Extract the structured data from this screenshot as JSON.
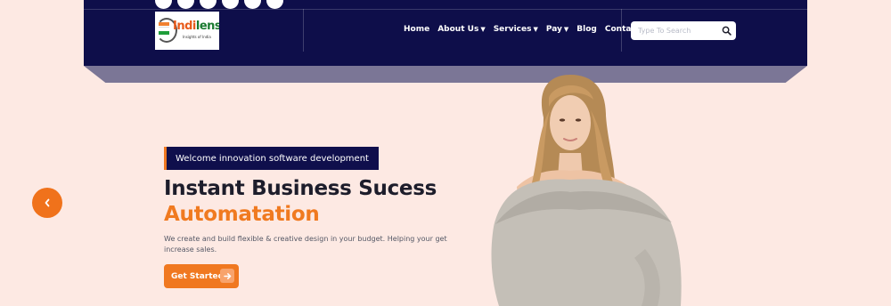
{
  "header": {
    "logo": {
      "name": "Indilens",
      "name_part1": "Indi",
      "name_part2": "lens",
      "tagline": "Insights of India"
    },
    "social_icons": [
      "social-icon-1",
      "social-icon-2",
      "social-icon-3",
      "social-icon-4",
      "social-icon-5",
      "social-icon-6"
    ],
    "nav": [
      {
        "label": "Home",
        "has_dropdown": false
      },
      {
        "label": "About Us",
        "has_dropdown": true
      },
      {
        "label": "Services",
        "has_dropdown": true
      },
      {
        "label": "Pay",
        "has_dropdown": true
      },
      {
        "label": "Blog",
        "has_dropdown": false
      },
      {
        "label": "Contact Us",
        "has_dropdown": false
      }
    ],
    "search": {
      "placeholder": "Type To Search",
      "value": "",
      "icon": "search-icon"
    }
  },
  "hero": {
    "tagline": "Welcome innovation software development",
    "title_line1": "Instant Business Sucess",
    "title_line2": "Automatation",
    "description": "We create and build flexible & creative design in your budget. Helping your get increase sales.",
    "cta_label": "Get Started",
    "cta_icon": "arrow-right-icon",
    "prev_icon": "chevron-left-icon",
    "image": "woman-in-off-shoulder-sweater"
  },
  "colors": {
    "header_bg": "#0e0e4a",
    "page_bg": "#fde9e3",
    "accent": "#f07820",
    "title_dark": "#1d1d2b"
  }
}
